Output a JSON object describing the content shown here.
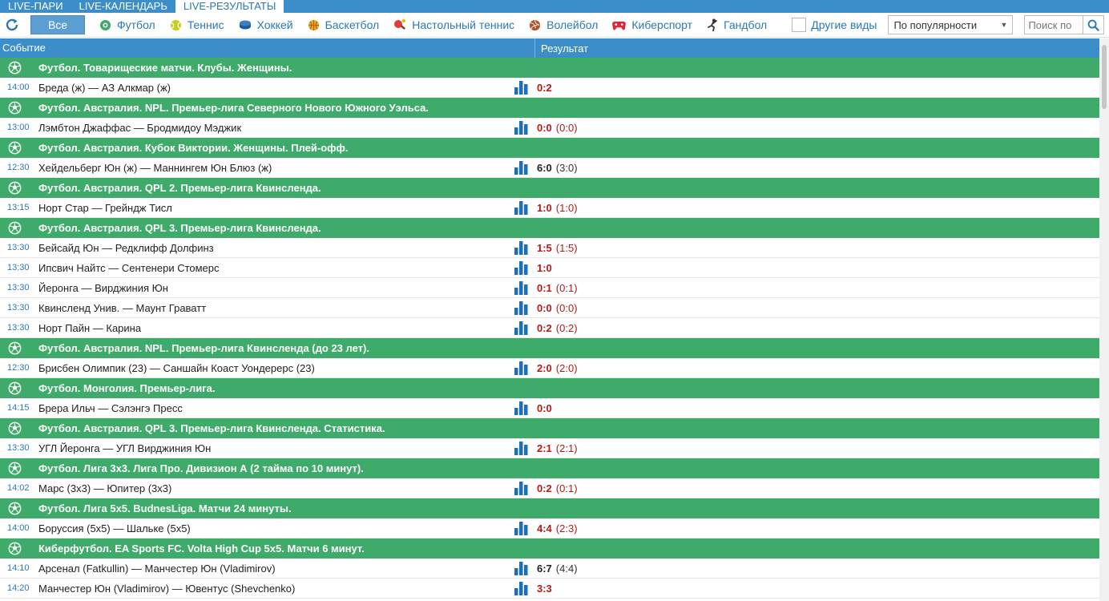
{
  "top_tabs": [
    {
      "label": "LIVE-ПАРИ",
      "active": false
    },
    {
      "label": "LIVE-КАЛЕНДАРЬ",
      "active": false
    },
    {
      "label": "LIVE-РЕЗУЛЬТАТЫ",
      "active": true
    }
  ],
  "filter": {
    "all_label": "Все",
    "sports": [
      {
        "label": "Футбол",
        "icon": "soccer-ball-icon"
      },
      {
        "label": "Теннис",
        "icon": "tennis-ball-icon"
      },
      {
        "label": "Хоккей",
        "icon": "hockey-puck-icon"
      },
      {
        "label": "Баскетбол",
        "icon": "basketball-icon"
      },
      {
        "label": "Настольный теннис",
        "icon": "table-tennis-icon"
      },
      {
        "label": "Волейбол",
        "icon": "volleyball-icon"
      },
      {
        "label": "Киберспорт",
        "icon": "gamepad-icon"
      },
      {
        "label": "Гандбол",
        "icon": "handball-icon"
      }
    ],
    "other_label": "Другие виды",
    "sort_value": "По популярности",
    "search_placeholder": "Поиск по"
  },
  "columns": {
    "event": "Событие",
    "result": "Результат"
  },
  "sections": [
    {
      "league": "Футбол. Товарищеские матчи. Клубы. Женщины.",
      "matches": [
        {
          "time": "14:00",
          "teams": "Бреда (ж) — АЗ Алкмар (ж)",
          "score": "0:2",
          "half": "",
          "score_color": "red"
        }
      ]
    },
    {
      "league": "Футбол. Австралия. NPL. Премьер-лига Северного Нового Южного Уэльса.",
      "matches": [
        {
          "time": "13:00",
          "teams": "Лэмбтон Джаффас — Бродмидоу Мэджик",
          "score": "0:0",
          "half": "(0:0)",
          "score_color": "red"
        }
      ]
    },
    {
      "league": "Футбол. Австралия. Кубок Виктории. Женщины. Плей-офф.",
      "matches": [
        {
          "time": "12:30",
          "teams": "Хейдельберг Юн (ж) — Маннингем Юн Блюз (ж)",
          "score": "6:0",
          "half": "(3:0)",
          "score_color": "black"
        }
      ]
    },
    {
      "league": "Футбол. Австралия. QPL 2. Премьер-лига Квинсленда.",
      "matches": [
        {
          "time": "13:15",
          "teams": "Норт Стар — Грейндж Тисл",
          "score": "1:0",
          "half": "(1:0)",
          "score_color": "red"
        }
      ]
    },
    {
      "league": "Футбол. Австралия. QPL 3. Премьер-лига Квинсленда.",
      "matches": [
        {
          "time": "13:30",
          "teams": "Бейсайд Юн — Редклифф Долфинз",
          "score": "1:5",
          "half": "(1:5)",
          "score_color": "red"
        },
        {
          "time": "13:30",
          "teams": "Ипсвич Найтс — Сентенери Стомерс",
          "score": "1:0",
          "half": "",
          "score_color": "red"
        },
        {
          "time": "13:30",
          "teams": "Йеронга — Вирджиния Юн",
          "score": "0:1",
          "half": "(0:1)",
          "score_color": "red"
        },
        {
          "time": "13:30",
          "teams": "Квинсленд Унив. — Маунт Граватт",
          "score": "0:0",
          "half": "(0:0)",
          "score_color": "red"
        },
        {
          "time": "13:30",
          "teams": "Норт Пайн — Карина",
          "score": "0:2",
          "half": "(0:2)",
          "score_color": "red"
        }
      ]
    },
    {
      "league": "Футбол. Австралия. NPL. Премьер-лига Квинсленда (до 23 лет).",
      "matches": [
        {
          "time": "12:30",
          "teams": "Брисбен Олимпик (23) — Саншайн Коаст Уондерерс (23)",
          "score": "2:0",
          "half": "(2:0)",
          "score_color": "red"
        }
      ]
    },
    {
      "league": "Футбол. Монголия. Премьер-лига.",
      "matches": [
        {
          "time": "14:15",
          "teams": "Брера Ильч — Сэлэнгэ Пресс",
          "score": "0:0",
          "half": "",
          "score_color": "red"
        }
      ]
    },
    {
      "league": "Футбол. Австралия. QPL 3. Премьер-лига Квинсленда. Статистика.",
      "matches": [
        {
          "time": "13:30",
          "teams": "УГЛ Йеронга — УГЛ Вирджиния Юн",
          "score": "2:1",
          "half": "(2:1)",
          "score_color": "red"
        }
      ]
    },
    {
      "league": "Футбол. Лига 3х3. Лига Про. Дивизион А (2 тайма по 10 минут).",
      "matches": [
        {
          "time": "14:02",
          "teams": "Марс (3х3) — Юпитер (3х3)",
          "score": "0:2",
          "half": "(0:1)",
          "score_color": "red"
        }
      ]
    },
    {
      "league": "Футбол. Лига 5х5. BudnesLiga. Матчи 24 минуты.",
      "matches": [
        {
          "time": "14:00",
          "teams": "Боруссия (5х5) — Шальке (5х5)",
          "score": "4:4",
          "half": "(2:3)",
          "score_color": "red"
        }
      ]
    },
    {
      "league": "Киберфутбол. EA Sports FC. Volta High Cup 5x5. Матчи 6 минут.",
      "matches": [
        {
          "time": "14:10",
          "teams": "Арсенал (Fatkullin) — Манчестер Юн (Vladimirov)",
          "score": "6:7",
          "half": "(4:4)",
          "score_color": "black"
        },
        {
          "time": "14:20",
          "teams": "Манчестер Юн (Vladimirov) — Ювентус (Shevchenko)",
          "score": "3:3",
          "half": "",
          "score_color": "red"
        }
      ]
    }
  ],
  "colors": {
    "accent": "#3b8ec9",
    "league_bg": "#3fab6a",
    "score_red": "#b01c1c",
    "link": "#2a78b5"
  }
}
